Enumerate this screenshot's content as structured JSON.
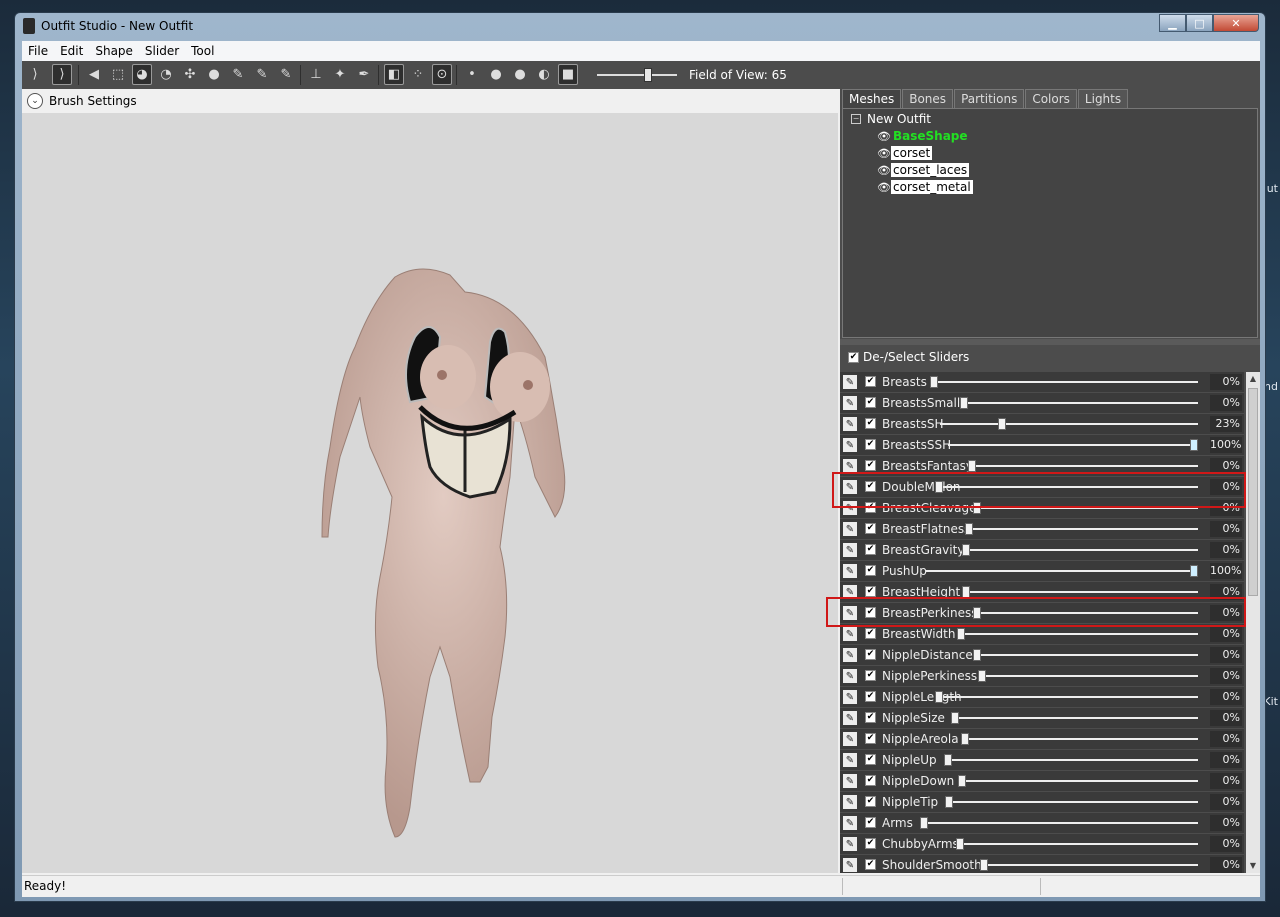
{
  "window": {
    "title": "Outfit Studio - New Outfit"
  },
  "window_buttons": {
    "minimize": "▁",
    "maximize": "□",
    "close": "✕"
  },
  "menu": [
    {
      "label": "File"
    },
    {
      "label": "Edit"
    },
    {
      "label": "Shape"
    },
    {
      "label": "Slider"
    },
    {
      "label": "Tool"
    }
  ],
  "toolbar": {
    "field_of_view_label": "Field of View: 65",
    "fov": {
      "min": 0,
      "max": 100,
      "value": 65
    }
  },
  "viewport": {
    "brush_settings_label": "Brush Settings"
  },
  "tabs": [
    {
      "label": "Meshes",
      "active": true
    },
    {
      "label": "Bones"
    },
    {
      "label": "Partitions"
    },
    {
      "label": "Colors"
    },
    {
      "label": "Lights"
    }
  ],
  "tree": {
    "root": "New Outfit",
    "items": [
      {
        "label": "BaseShape"
      },
      {
        "label": "corset"
      },
      {
        "label": "corset_laces"
      },
      {
        "label": "corset_metal"
      }
    ]
  },
  "sliders_header": {
    "label": "De-/Select Sliders"
  },
  "sliders": [
    {
      "name": "Breasts",
      "value": "0%",
      "pos": 0
    },
    {
      "name": "BreastsSmall",
      "value": "0%",
      "pos": 0
    },
    {
      "name": "BreastsSH",
      "value": "23%",
      "pos": 23
    },
    {
      "name": "BreastsSSH",
      "value": "100%",
      "pos": 100
    },
    {
      "name": "BreastsFantasy",
      "value": "0%",
      "pos": 0
    },
    {
      "name": "DoubleMelon",
      "value": "0%",
      "pos": 0
    },
    {
      "name": "BreastCleavage",
      "value": "0%",
      "pos": 0
    },
    {
      "name": "BreastFlatness",
      "value": "0%",
      "pos": 0
    },
    {
      "name": "BreastGravity",
      "value": "0%",
      "pos": 0
    },
    {
      "name": "PushUp",
      "value": "100%",
      "pos": 100
    },
    {
      "name": "BreastHeight",
      "value": "0%",
      "pos": 0
    },
    {
      "name": "BreastPerkiness",
      "value": "0%",
      "pos": 0
    },
    {
      "name": "BreastWidth",
      "value": "0%",
      "pos": 0
    },
    {
      "name": "NippleDistance",
      "value": "0%",
      "pos": 0
    },
    {
      "name": "NipplePerkiness",
      "value": "0%",
      "pos": 0
    },
    {
      "name": "NippleLength",
      "value": "0%",
      "pos": 0
    },
    {
      "name": "NippleSize",
      "value": "0%",
      "pos": 0
    },
    {
      "name": "NippleAreola",
      "value": "0%",
      "pos": 0
    },
    {
      "name": "NippleUp",
      "value": "0%",
      "pos": 0
    },
    {
      "name": "NippleDown",
      "value": "0%",
      "pos": 0
    },
    {
      "name": "NippleTip",
      "value": "0%",
      "pos": 0
    },
    {
      "name": "Arms",
      "value": "0%",
      "pos": 0
    },
    {
      "name": "ChubbyArms",
      "value": "0%",
      "pos": 0
    },
    {
      "name": "ShoulderSmooth",
      "value": "0%",
      "pos": 0
    }
  ],
  "status": {
    "text": "Ready!"
  }
}
